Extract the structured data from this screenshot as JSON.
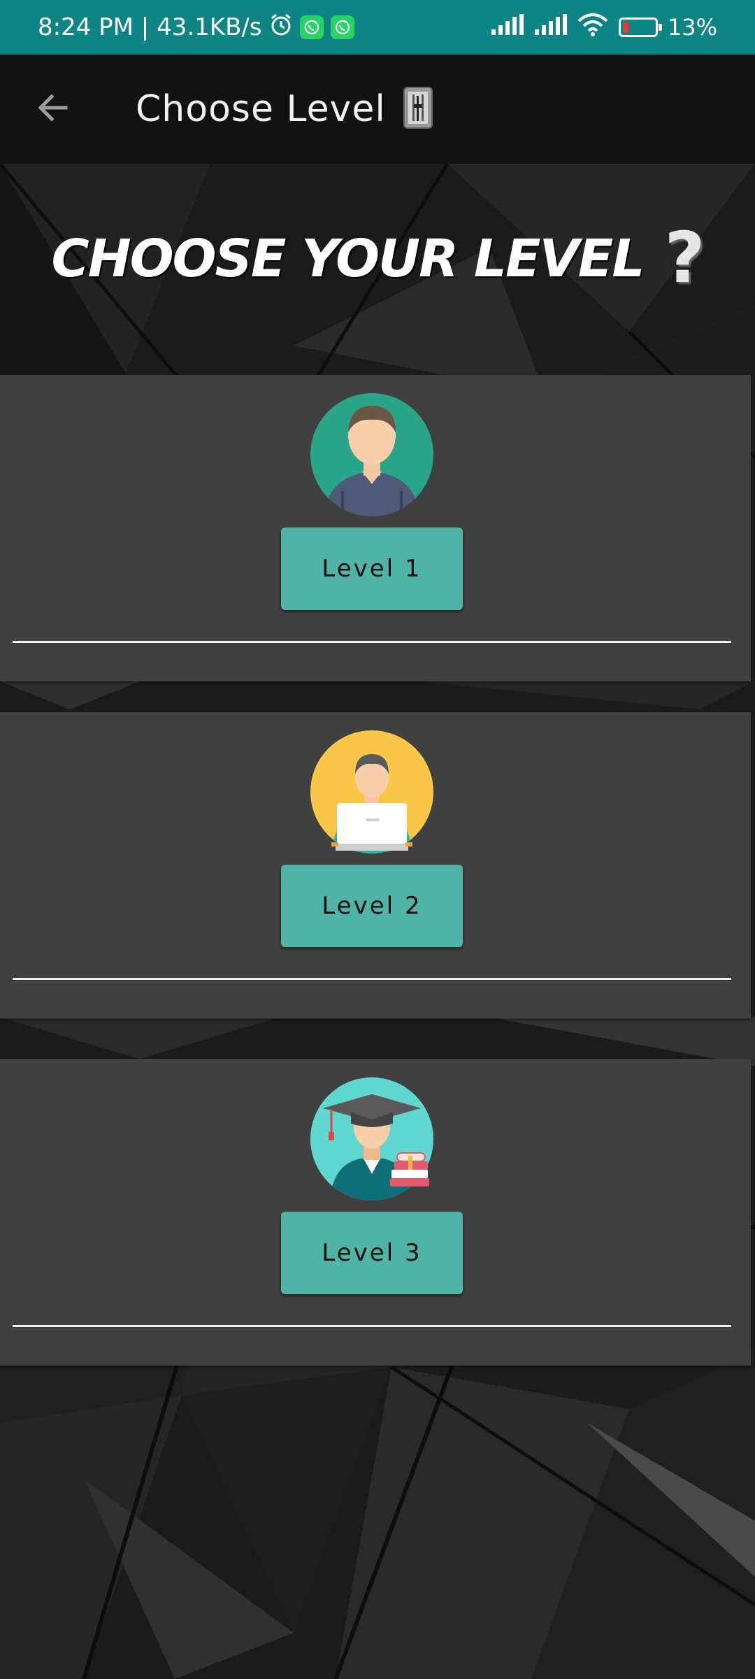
{
  "status_bar": {
    "time_speed": "8:24 PM | 43.1KB/s",
    "battery": "13%",
    "icons": [
      "alarm-icon",
      "whatsapp-icon",
      "whatsapp-icon",
      "signal-icon",
      "signal-icon",
      "wifi-icon",
      "battery-icon"
    ]
  },
  "app_bar": {
    "title": "Choose Level",
    "back_icon": "arrow-back-icon",
    "title_icon": "level-slider-icon"
  },
  "heading": {
    "text": "CHOOSE YOUR LEVEL",
    "mark": "?"
  },
  "levels": [
    {
      "label": "Level 1",
      "avatar": "person-avatar-icon",
      "avatar_bg": "#2aa58a"
    },
    {
      "label": "Level 2",
      "avatar": "person-laptop-avatar-icon",
      "avatar_bg": "#fbc748"
    },
    {
      "label": "Level 3",
      "avatar": "graduate-avatar-icon",
      "avatar_bg": "#5fd6cf"
    }
  ],
  "colors": {
    "status_bar": "#0d8585",
    "app_bar": "#121212",
    "card": "#404040",
    "button": "#4fb3a5"
  }
}
